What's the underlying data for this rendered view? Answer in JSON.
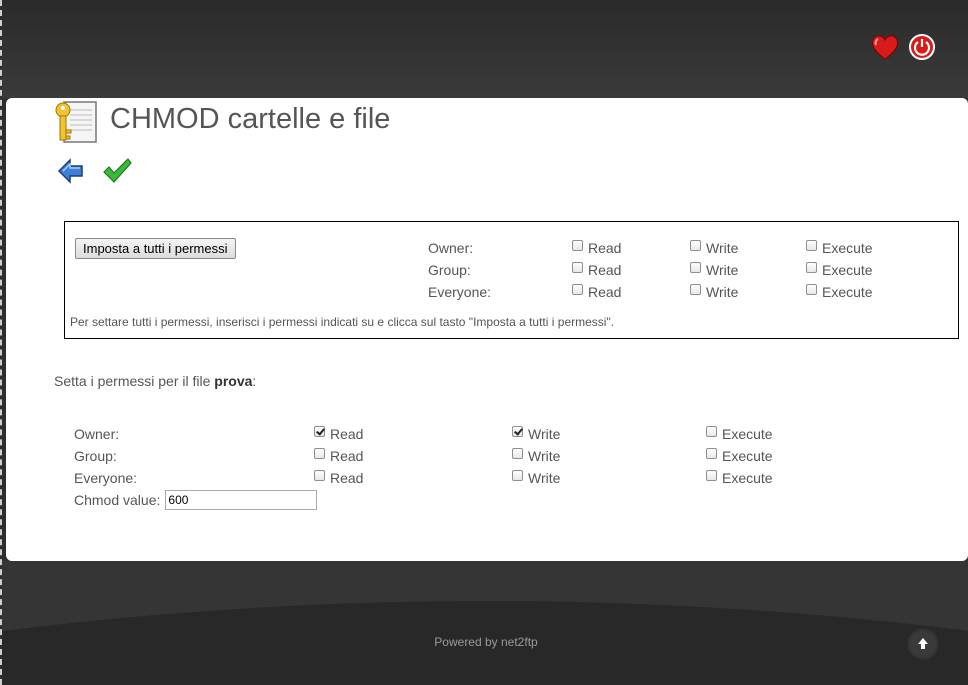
{
  "header": {
    "favorite_icon": "heart-icon",
    "logout_icon": "power-icon",
    "accent": "#d81a1a"
  },
  "page": {
    "title": "CHMOD cartelle e file",
    "page_icon": "key-document-icon",
    "back_icon": "back-arrow-icon",
    "submit_icon": "checkmark-icon"
  },
  "bulk": {
    "button_label": "Imposta a tutti i permessi",
    "rows": [
      {
        "label": "Owner:",
        "read": "Read",
        "write": "Write",
        "execute": "Execute"
      },
      {
        "label": "Group:",
        "read": "Read",
        "write": "Write",
        "execute": "Execute"
      },
      {
        "label": "Everyone:",
        "read": "Read",
        "write": "Write",
        "execute": "Execute"
      }
    ],
    "note": "Per settare tutti i permessi, inserisci i permessi indicati su e clicca sul tasto \"Imposta a tutti i permessi\"."
  },
  "file": {
    "label_prefix": "Setta i permessi per il file ",
    "file_name": "prova",
    "label_suffix": ":",
    "rows": [
      {
        "label": "Owner:",
        "read": "Read",
        "write": "Write",
        "execute": "Execute"
      },
      {
        "label": "Group:",
        "read": "Read",
        "write": "Write",
        "execute": "Execute"
      },
      {
        "label": "Everyone:",
        "read": "Read",
        "write": "Write",
        "execute": "Execute"
      }
    ],
    "chmod_label": "Chmod value:",
    "chmod_value": "600"
  },
  "footer": {
    "powered": "Powered by net2ftp",
    "to_top_icon": "arrow-up-icon"
  }
}
